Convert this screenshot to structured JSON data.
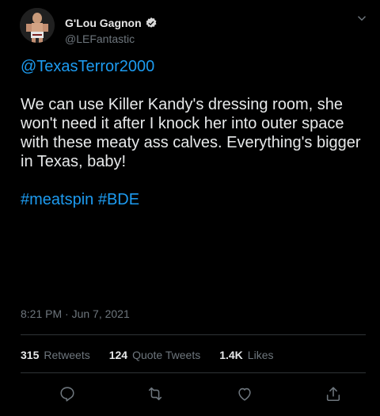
{
  "tweet": {
    "display_name": "G'Lou Gagnon",
    "handle": "@LEFantastic",
    "mention": "@TexasTerror2000",
    "text": "We can use Killer Kandy's dressing room, she won't need it after I knock her into outer space with these meaty ass calves. Everything's bigger in Texas, baby!",
    "hashtags": "#meatspin #BDE",
    "timestamp": "8:21 PM · Jun 7, 2021"
  },
  "stats": {
    "retweets_count": "315",
    "retweets_label": "Retweets",
    "quote_count": "124",
    "quote_label": "Quote Tweets",
    "likes_count": "1.4K",
    "likes_label": "Likes"
  },
  "icons": {
    "verified": "verified-badge-icon",
    "menu": "chevron-down-icon",
    "reply": "reply-icon",
    "retweet": "retweet-icon",
    "like": "heart-icon",
    "share": "share-icon"
  },
  "colors": {
    "background": "#000000",
    "accent": "#1d9bf0",
    "muted": "#6e767d",
    "text": "#e7e9ea",
    "divider": "#2f3336"
  }
}
